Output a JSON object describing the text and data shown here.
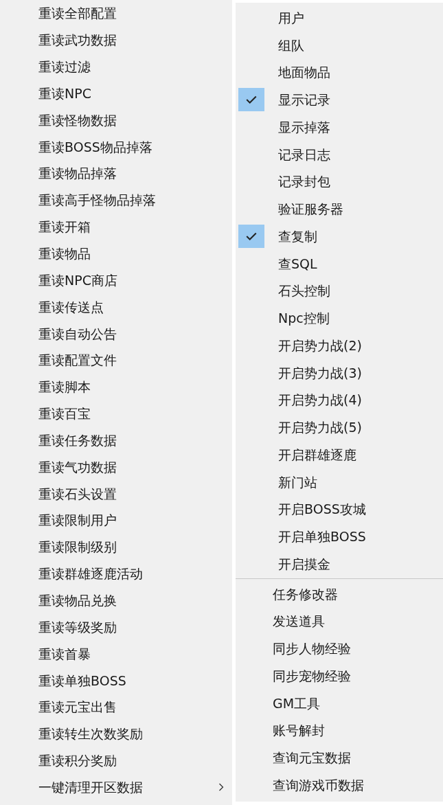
{
  "left_menu": {
    "items": [
      {
        "label": "重读全部配置",
        "submenu": false
      },
      {
        "label": "重读武功数据",
        "submenu": false
      },
      {
        "label": "重读过滤",
        "submenu": false
      },
      {
        "label": "重读NPC",
        "submenu": false
      },
      {
        "label": "重读怪物数据",
        "submenu": false
      },
      {
        "label": "重读BOSS物品掉落",
        "submenu": false
      },
      {
        "label": "重读物品掉落",
        "submenu": false
      },
      {
        "label": "重读高手怪物品掉落",
        "submenu": false
      },
      {
        "label": "重读开箱",
        "submenu": false
      },
      {
        "label": "重读物品",
        "submenu": false
      },
      {
        "label": "重读NPC商店",
        "submenu": false
      },
      {
        "label": "重读传送点",
        "submenu": false
      },
      {
        "label": "重读自动公告",
        "submenu": false
      },
      {
        "label": "重读配置文件",
        "submenu": false
      },
      {
        "label": "重读脚本",
        "submenu": false
      },
      {
        "label": "重读百宝",
        "submenu": false
      },
      {
        "label": "重读任务数据",
        "submenu": false
      },
      {
        "label": "重读气功数据",
        "submenu": false
      },
      {
        "label": "重读石头设置",
        "submenu": false
      },
      {
        "label": "重读限制用户",
        "submenu": false
      },
      {
        "label": "重读限制级别",
        "submenu": false
      },
      {
        "label": "重读群雄逐鹿活动",
        "submenu": false
      },
      {
        "label": "重读物品兑换",
        "submenu": false
      },
      {
        "label": "重读等级奖励",
        "submenu": false
      },
      {
        "label": "重读首暴",
        "submenu": false
      },
      {
        "label": "重读单独BOSS",
        "submenu": false
      },
      {
        "label": "重读元宝出售",
        "submenu": false
      },
      {
        "label": "重读转生次数奖励",
        "submenu": false
      },
      {
        "label": "重读积分奖励",
        "submenu": false
      },
      {
        "label": "一键清理开区数据",
        "submenu": true
      }
    ]
  },
  "right_menu": {
    "sections": [
      {
        "items": [
          {
            "label": "用户",
            "checked": false
          },
          {
            "label": "组队",
            "checked": false
          },
          {
            "label": "地面物品",
            "checked": false
          },
          {
            "label": "显示记录",
            "checked": true
          },
          {
            "label": "显示掉落",
            "checked": false
          },
          {
            "label": "记录日志",
            "checked": false
          },
          {
            "label": "记录封包",
            "checked": false
          },
          {
            "label": "验证服务器",
            "checked": false
          },
          {
            "label": "查复制",
            "checked": true
          },
          {
            "label": "查SQL",
            "checked": false
          },
          {
            "label": "石头控制",
            "checked": false
          },
          {
            "label": "Npc控制",
            "checked": false
          },
          {
            "label": "开启势力战(2)",
            "checked": false
          },
          {
            "label": "开启势力战(3)",
            "checked": false
          },
          {
            "label": "开启势力战(4)",
            "checked": false
          },
          {
            "label": "开启势力战(5)",
            "checked": false
          },
          {
            "label": "开启群雄逐鹿",
            "checked": false
          },
          {
            "label": "新门站",
            "checked": false
          },
          {
            "label": "开启BOSS攻城",
            "checked": false
          },
          {
            "label": "开启单独BOSS",
            "checked": false
          },
          {
            "label": "开启摸金",
            "checked": false
          }
        ]
      },
      {
        "items": [
          {
            "label": "任务修改器"
          },
          {
            "label": "发送道具"
          },
          {
            "label": "同步人物经验"
          },
          {
            "label": "同步宠物经验"
          },
          {
            "label": "GM工具"
          },
          {
            "label": "账号解封"
          },
          {
            "label": "查询元宝数据"
          },
          {
            "label": "查询游戏币数据"
          }
        ]
      }
    ]
  }
}
